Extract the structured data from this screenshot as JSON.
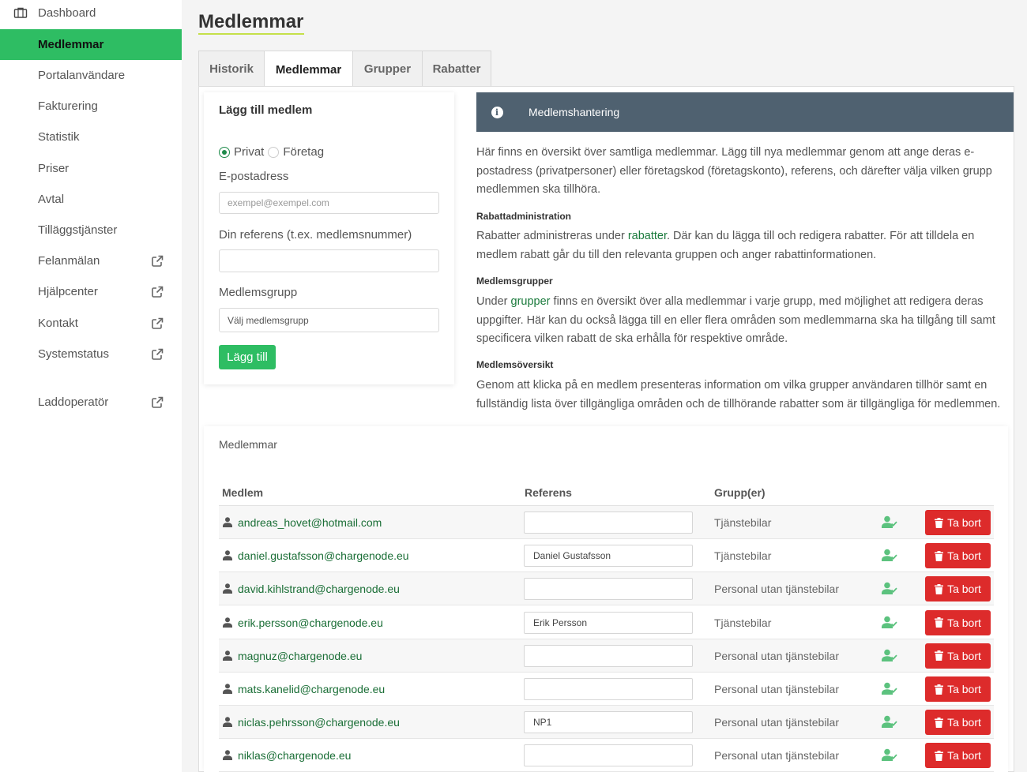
{
  "sidebar": {
    "items": [
      {
        "label": "Dashboard",
        "external": false
      },
      {
        "label": "Medlemmar",
        "external": false,
        "active": true
      },
      {
        "label": "Portalanvändare",
        "external": false
      },
      {
        "label": "Fakturering",
        "external": false
      },
      {
        "label": "Statistik",
        "external": false
      },
      {
        "label": "Priser",
        "external": false
      },
      {
        "label": "Avtal",
        "external": false
      },
      {
        "label": "Tilläggstjänster",
        "external": false
      },
      {
        "label": "Felanmälan",
        "external": true
      },
      {
        "label": "Hjälpcenter",
        "external": true
      },
      {
        "label": "Kontakt",
        "external": true
      },
      {
        "label": "Systemstatus",
        "external": true
      },
      {
        "label": "Laddoperatör",
        "external": true
      }
    ],
    "accent_color": "#2ebd63"
  },
  "page": {
    "title": "Medlemmar"
  },
  "tabs": [
    {
      "label": "Historik"
    },
    {
      "label": "Medlemmar",
      "active": true
    },
    {
      "label": "Grupper"
    },
    {
      "label": "Rabatter"
    }
  ],
  "add_member": {
    "title": "Lägg till medlem",
    "radio_private": "Privat",
    "radio_company": "Företag",
    "selected_type": "Privat",
    "email_label": "E-postadress",
    "email_placeholder": "exempel@exempel.com",
    "ref_label": "Din referens (t.ex. medlemsnummer)",
    "ref_value": "",
    "group_label": "Medlemsgrupp",
    "group_select": "Välj medlemsgrupp",
    "submit_label": "Lägg till"
  },
  "info": {
    "title": "Medlemshantering",
    "icon": "info-icon",
    "intro": "Här finns en översikt över samtliga medlemmar. Lägg till nya medlemmar genom att ange deras e-postadress (privatpersoner) eller företagskod (företagskonto), referens, och därefter välja vilken grupp medlemmen ska tillhöra.",
    "s1_title": "Rabattadministration",
    "s1_pre": "Rabatter administreras under ",
    "s1_link": "rabatter",
    "s1_post": ". Där kan du lägga till och redigera rabatter. För att tilldela en medlem rabatt går du till den relevanta gruppen och anger rabattinformationen.",
    "s2_title": "Medlemsgrupper",
    "s2_pre": "Under ",
    "s2_link": "grupper",
    "s2_post": " finns en översikt över alla medlemmar i varje grupp, med möjlighet att redigera deras uppgifter. Här kan du också lägga till en eller flera områden som medlemmarna ska ha tillgång till samt specificera vilken rabatt de ska erhålla för respektive område.",
    "s3_title": "Medlemsöversikt",
    "s3_text": "Genom att klicka på en medlem presenteras information om vilka grupper användaren tillhör samt en fullständig lista över tillgängliga områden och de tillhörande rabatter som är tillgängliga för medlemmen."
  },
  "members": {
    "title": "Medlemmar",
    "columns": [
      "Medlem",
      "Referens",
      "Grupp(er)"
    ],
    "delete_label": "Ta bort",
    "rows": [
      {
        "email": "andreas_hovet@hotmail.com",
        "ref": "",
        "group": "Tjänstebilar"
      },
      {
        "email": "daniel.gustafsson@chargenode.eu",
        "ref": "Daniel Gustafsson",
        "group": "Tjänstebilar"
      },
      {
        "email": "david.kihlstrand@chargenode.eu",
        "ref": "",
        "group": "Personal utan tjänstebilar"
      },
      {
        "email": "erik.persson@chargenode.eu",
        "ref": "Erik Persson",
        "group": "Tjänstebilar"
      },
      {
        "email": "magnuz@chargenode.eu",
        "ref": "",
        "group": "Personal utan tjänstebilar"
      },
      {
        "email": "mats.kanelid@chargenode.eu",
        "ref": "",
        "group": "Personal utan tjänstebilar"
      },
      {
        "email": "niclas.pehrsson@chargenode.eu",
        "ref": "NP1",
        "group": "Personal utan tjänstebilar"
      },
      {
        "email": "niklas@chargenode.eu",
        "ref": "",
        "group": "Personal utan tjänstebilar"
      }
    ],
    "delete_color": "#dd2b2b"
  }
}
